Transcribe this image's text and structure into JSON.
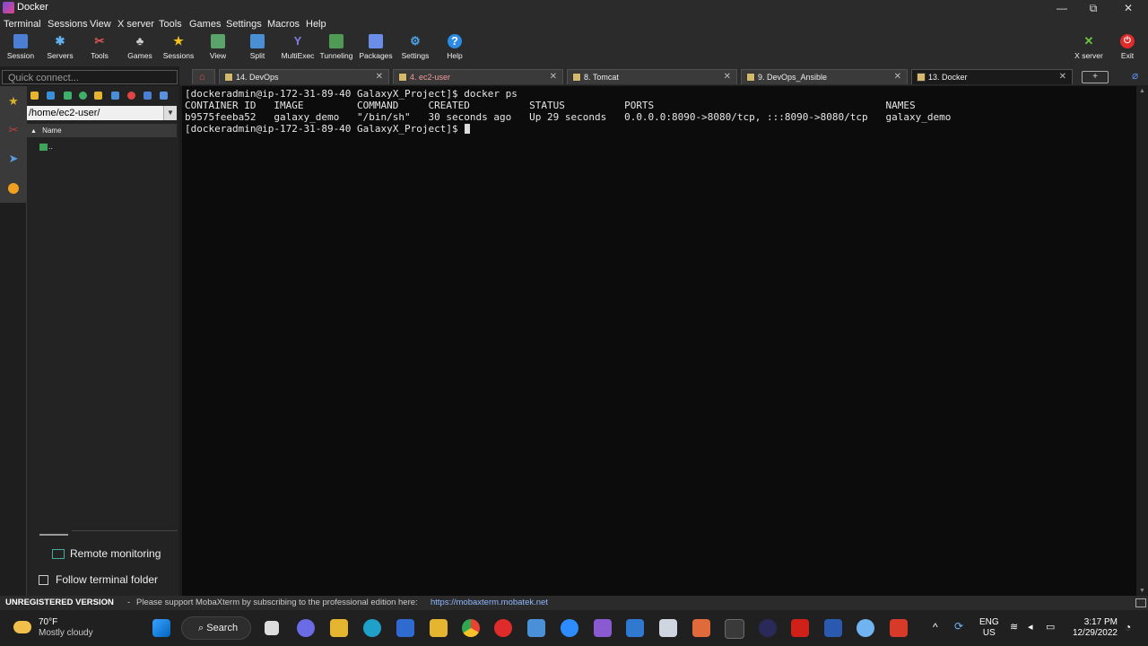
{
  "window": {
    "title": "Docker",
    "min_glyph": "—",
    "max_glyph": "⧉",
    "close_glyph": "✕"
  },
  "menu": [
    "Terminal",
    "Sessions",
    "View",
    "X server",
    "Tools",
    "Games",
    "Settings",
    "Macros",
    "Help"
  ],
  "toolbar": {
    "items": [
      "Session",
      "Servers",
      "Tools",
      "Games",
      "Sessions",
      "View",
      "Split",
      "MultiExec",
      "Tunneling",
      "Packages",
      "Settings",
      "Help"
    ],
    "right_items": [
      "X server",
      "Exit"
    ]
  },
  "quick_connect": {
    "placeholder": "Quick connect..."
  },
  "tabs": [
    {
      "label": "14. DevOps",
      "active": false
    },
    {
      "label": "4. ec2-user",
      "active": false
    },
    {
      "label": "8. Tomcat",
      "active": false
    },
    {
      "label": "9. DevOps_Ansible",
      "active": false
    },
    {
      "label": "13. Docker",
      "active": true
    }
  ],
  "tab_close_glyph": "✕",
  "tab_add_glyph": "+",
  "sftp": {
    "path": "/home/ec2-user/",
    "column_name": "Name",
    "items": [
      ".."
    ],
    "remote_monitoring": "Remote monitoring",
    "follow_terminal": "Follow terminal folder"
  },
  "terminal": {
    "lines": [
      "[dockeradmin@ip-172-31-89-40 GalaxyX_Project]$ docker ps",
      "CONTAINER ID   IMAGE         COMMAND     CREATED          STATUS          PORTS                                       NAMES",
      "b9575feeba52   galaxy_demo   \"/bin/sh\"   30 seconds ago   Up 29 seconds   0.0.0.0:8090->8080/tcp, :::8090->8080/tcp   galaxy_demo",
      "[dockeradmin@ip-172-31-89-40 GalaxyX_Project]$ "
    ]
  },
  "status": {
    "unregistered": "UNREGISTERED VERSION",
    "dash": "-",
    "support": "Please support MobaXterm by subscribing to the professional edition here:",
    "link": "https://mobaxterm.mobatek.net"
  },
  "taskbar": {
    "weather_temp": "70°F",
    "weather_desc": "Mostly cloudy",
    "search": "Search",
    "lang": "ENG",
    "region": "US",
    "time": "3:17 PM",
    "date": "12/29/2022"
  },
  "colors": {
    "accent": "#0078d4",
    "terminal_bg": "#0c0c0c",
    "chrome_bg": "#2b2b2b"
  }
}
